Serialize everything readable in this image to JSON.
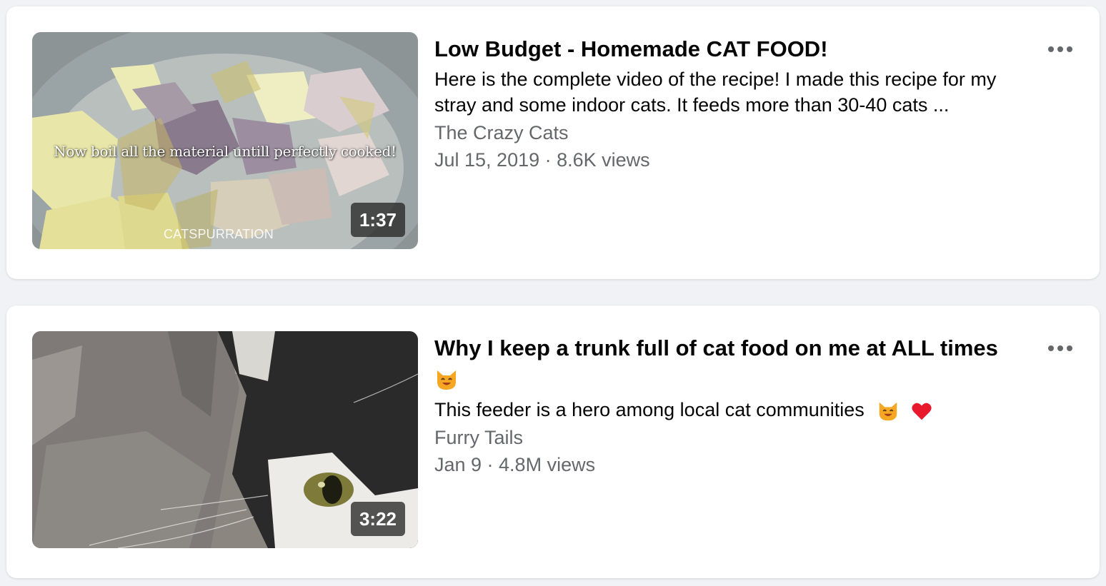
{
  "videos": [
    {
      "title": "Low Budget - Homemade CAT FOOD!",
      "description": "Here is the complete video of the recipe! I made this recipe for my stray and some indoor cats. It feeds more than 30-40 cats ...",
      "channel": "The Crazy Cats",
      "meta": "Jul 15, 2019 · 8.6K views",
      "duration": "1:37",
      "thumbnail_caption": "Now boil all the material untill perfectly cooked!",
      "thumbnail_watermark": "CATSPURRATION",
      "more_icon": "more-options-icon"
    },
    {
      "title": "Why I keep a trunk full of cat food on me at ALL times",
      "title_emoji": "cat-smile-emoji",
      "description": "This feeder is a hero among local cat communities",
      "description_emojis": [
        "cat-smile-emoji",
        "heart-emoji"
      ],
      "channel": "Furry Tails",
      "meta": "Jan 9 · 4.8M views",
      "duration": "3:22",
      "more_icon": "more-options-icon"
    }
  ],
  "colors": {
    "background": "#f0f2f5",
    "card": "#ffffff",
    "primary_text": "#050505",
    "secondary_text": "#65676b",
    "heart": "#e8192c",
    "cat_emoji": "#f5a623"
  }
}
